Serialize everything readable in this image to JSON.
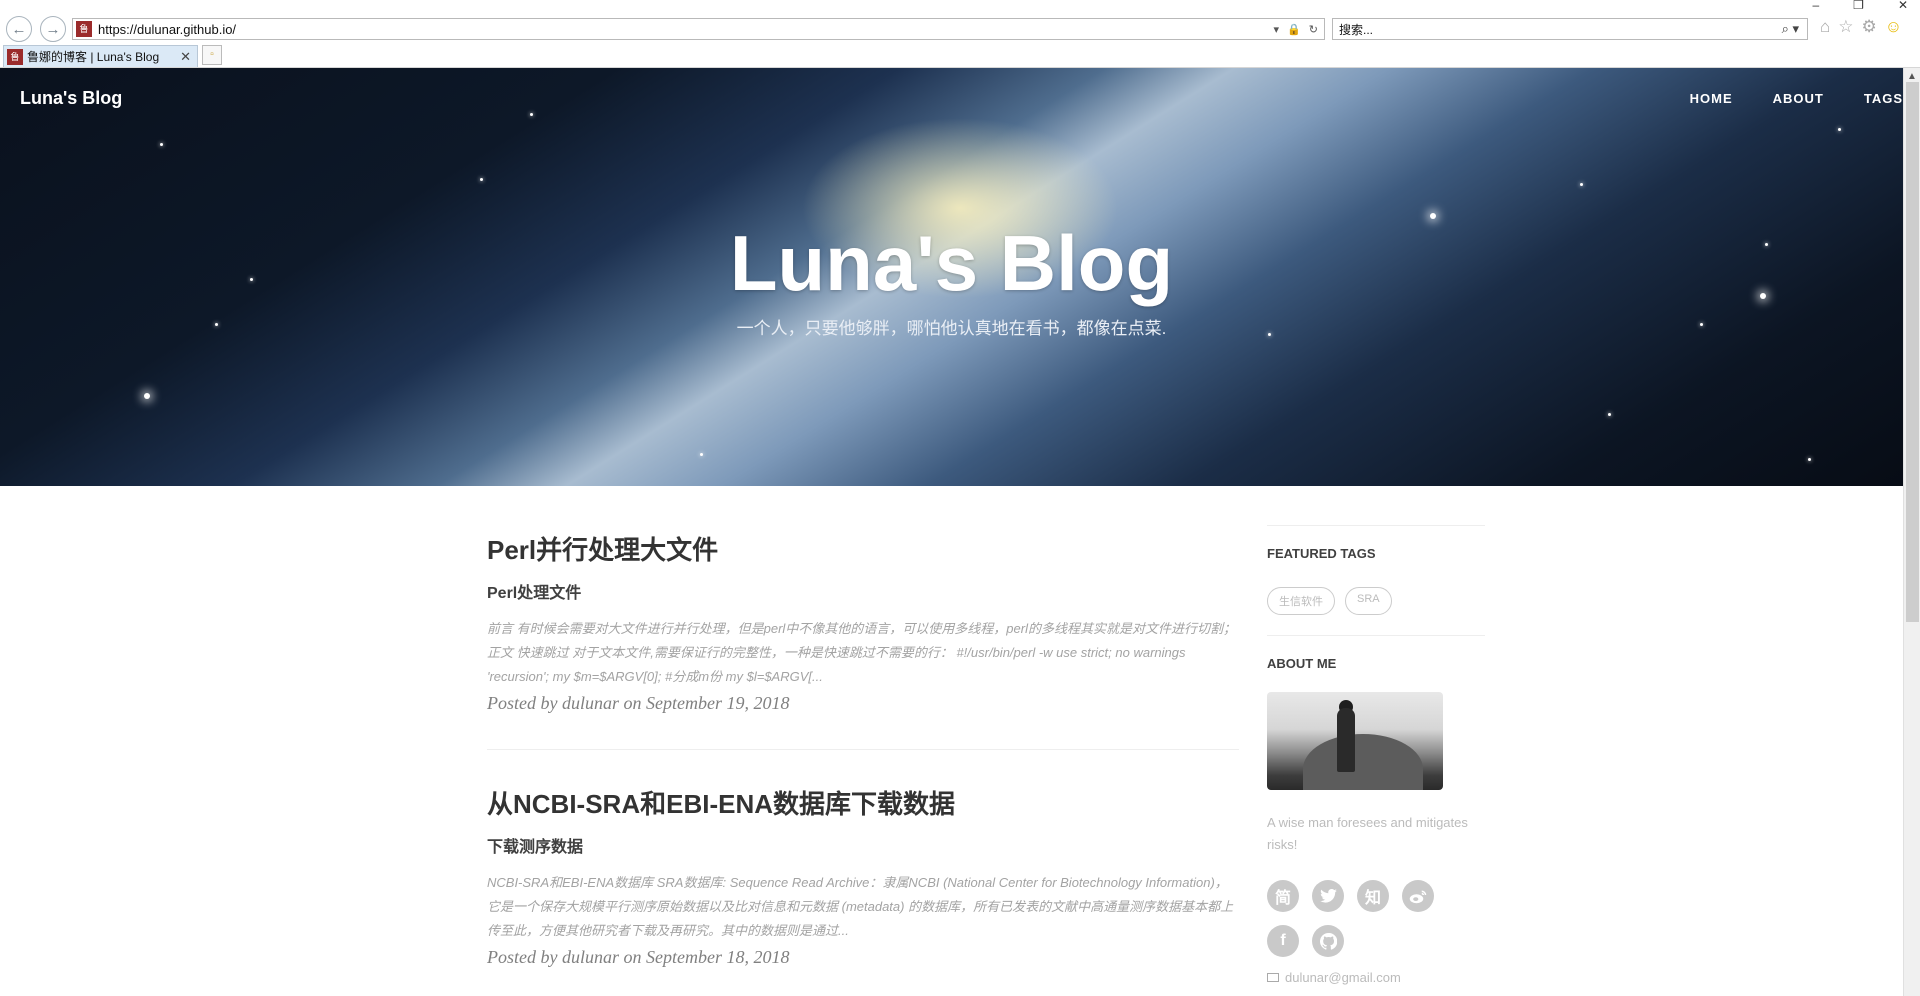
{
  "browser": {
    "url": "https://dulunar.github.io/",
    "search_placeholder": "搜索...",
    "tab_title": "鲁娜的博客 | Luna's Blog",
    "window_controls": [
      "–",
      "❐",
      "✕"
    ],
    "back_icon": "back-arrow-icon",
    "forward_icon": "forward-arrow-icon"
  },
  "site": {
    "brand": "Luna's Blog",
    "nav": [
      "HOME",
      "ABOUT",
      "TAGS"
    ],
    "hero_title": "Luna's Blog",
    "hero_subtitle": "一个人，只要他够胖，哪怕他认真地在看书，都像在点菜."
  },
  "posts": [
    {
      "title": "Perl并行处理大文件",
      "subtitle": "Perl处理文件",
      "excerpt": "前言 有时候会需要对大文件进行并行处理，但是perl中不像其他的语言，可以使用多线程，perl的多线程其实就是对文件进行切割； 正文 快速跳过 对于文本文件,需要保证行的完整性，一种是快速跳过不需要的行： #!/usr/bin/perl -w use strict; no warnings 'recursion'; my $m=$ARGV[0]; #分成m份 my $l=$ARGV[...",
      "meta": "Posted by dulunar on September 19, 2018"
    },
    {
      "title": "从NCBI-SRA和EBI-ENA数据库下载数据",
      "subtitle": "下载测序数据",
      "excerpt": "NCBI-SRA和EBI-ENA数据库 SRA数据库: Sequence Read Archive：隶属NCBI (National Center for Biotechnology Information)，它是一个保存大规模平行测序原始数据以及比对信息和元数据 (metadata) 的数据库，所有已发表的文献中高通量测序数据基本都上传至此，方便其他研究者下载及再研究。其中的数据则是通过...",
      "meta": "Posted by dulunar on September 18, 2018"
    }
  ],
  "sidebar": {
    "featured_tags_title": "FEATURED TAGS",
    "tags": [
      "生信软件",
      "SRA"
    ],
    "about_title": "ABOUT ME",
    "motto": "A wise man foresees and mitigates risks!",
    "socials": [
      {
        "name": "jianshu-icon",
        "glyph": "简"
      },
      {
        "name": "twitter-icon",
        "glyph": ""
      },
      {
        "name": "zhihu-icon",
        "glyph": "知"
      },
      {
        "name": "weibo-icon",
        "glyph": ""
      },
      {
        "name": "facebook-icon",
        "glyph": "f"
      },
      {
        "name": "github-icon",
        "glyph": ""
      }
    ],
    "email": "dulunar@gmail.com"
  }
}
